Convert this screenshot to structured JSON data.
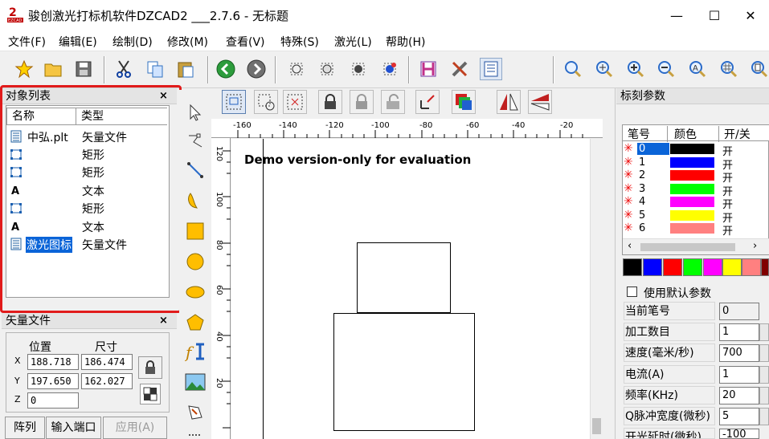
{
  "window": {
    "title": "骏创激光打标机软件DZCAD2 ___2.7.6 - 无标题",
    "logo_text": "EZCAD",
    "minimize": "—",
    "maximize": "☐",
    "close": "✕"
  },
  "menu": [
    "文件(F)",
    "编辑(E)",
    "绘制(D)",
    "修改(M)",
    "查看(V)",
    "特殊(S)",
    "激光(L)",
    "帮助(H)"
  ],
  "object_list": {
    "title": "对象列表",
    "close": "×",
    "col_name": "名称",
    "col_type": "类型",
    "rows": [
      {
        "name": "中弘.plt",
        "type": "矢量文件",
        "icon": "vector-file-icon"
      },
      {
        "name": "",
        "type": "矩形",
        "icon": "rectangle-icon"
      },
      {
        "name": "",
        "type": "矩形",
        "icon": "rectangle-icon"
      },
      {
        "name": "",
        "type": "文本",
        "icon": "text-icon"
      },
      {
        "name": "",
        "type": "矩形",
        "icon": "rectangle-icon"
      },
      {
        "name": "",
        "type": "文本",
        "icon": "text-icon"
      },
      {
        "name": "激光图标",
        "type": "矢量文件",
        "icon": "vector-file-icon",
        "selected": true
      }
    ]
  },
  "props": {
    "title": "矢量文件",
    "close": "×",
    "position_label": "位置",
    "size_label": "尺寸",
    "x_label": "X",
    "y_label": "Y",
    "z_label": "Z",
    "x_pos": "188.718",
    "x_size": "186.474",
    "y_pos": "197.650",
    "y_size": "162.027",
    "z_pos": "0",
    "array_button": "阵列",
    "input_port_button": "输入端口",
    "apply_button": "应用(A)"
  },
  "canvas": {
    "watermark": "Demo version-only for evaluation",
    "hruler": [
      "-160",
      "-140",
      "-120",
      "-100",
      "-80",
      "-60",
      "-40",
      "-20"
    ],
    "vruler": [
      "120",
      "100",
      "80",
      "60",
      "40",
      "20"
    ]
  },
  "mark_params": {
    "title": "标刻参数",
    "col_pen": "笔号",
    "col_color": "颜色",
    "col_onoff": "开/关",
    "pens": [
      {
        "num": "0",
        "color": "#000000",
        "state": "开",
        "selected": true
      },
      {
        "num": "1",
        "color": "#0000ff",
        "state": "开"
      },
      {
        "num": "2",
        "color": "#ff0000",
        "state": "开"
      },
      {
        "num": "3",
        "color": "#00ff00",
        "state": "开"
      },
      {
        "num": "4",
        "color": "#ff00ff",
        "state": "开"
      },
      {
        "num": "5",
        "color": "#ffff00",
        "state": "开"
      },
      {
        "num": "6",
        "color": "#ff8080",
        "state": "开"
      }
    ],
    "palette": [
      "#000000",
      "#0000ff",
      "#ff0000",
      "#00ff00",
      "#ff00ff",
      "#ffff00",
      "#ff8080",
      "#800000"
    ],
    "use_default_label": "使用默认参数",
    "fields": [
      {
        "label": "当前笔号",
        "value": "0"
      },
      {
        "label": "加工数目",
        "value": "1"
      },
      {
        "label": "速度(毫米/秒)",
        "value": "700"
      },
      {
        "label": "电流(A)",
        "value": "1"
      },
      {
        "label": "频率(KHz)",
        "value": "20"
      },
      {
        "label": "Q脉冲宽度(微秒)",
        "value": "5"
      },
      {
        "label": "开光延时(微秒)",
        "value": "-100"
      }
    ]
  }
}
